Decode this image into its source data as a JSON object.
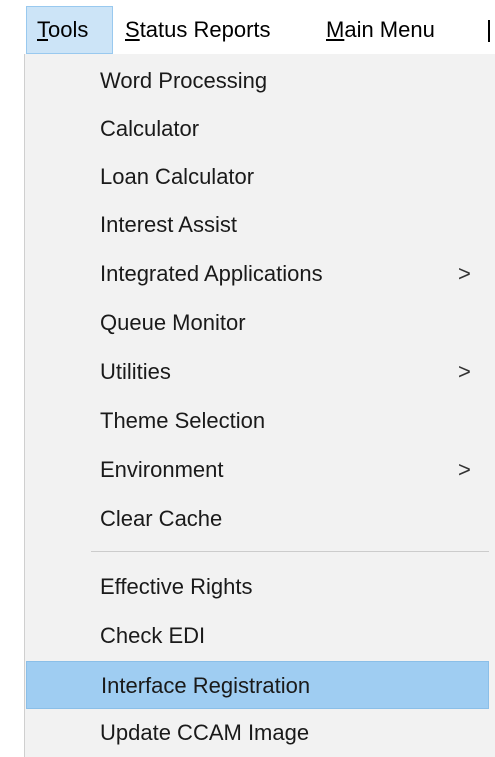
{
  "menubar": {
    "items": [
      {
        "label": "Tools"
      },
      {
        "label": "Status Reports"
      },
      {
        "label": "Main Menu"
      }
    ]
  },
  "tools_menu": {
    "group1": [
      {
        "label": "Word Processing"
      },
      {
        "label": "Calculator"
      },
      {
        "label": "Loan Calculator"
      },
      {
        "label": "Interest Assist"
      },
      {
        "label": "Integrated Applications",
        "submenu_glyph": ">"
      },
      {
        "label": "Queue Monitor"
      },
      {
        "label": "Utilities",
        "submenu_glyph": ">"
      },
      {
        "label": "Theme Selection"
      },
      {
        "label": "Environment",
        "submenu_glyph": ">"
      },
      {
        "label": "Clear Cache"
      }
    ],
    "group2": [
      {
        "label": "Effective Rights"
      },
      {
        "label": "Check EDI"
      },
      {
        "label": "Interface Registration",
        "state": "highlighted"
      },
      {
        "label": "Update CCAM Image"
      }
    ]
  },
  "colors": {
    "menu_background": "#f2f2f2",
    "highlight": "#9fcdf2",
    "open_menu_header": "#cce4f7"
  },
  "icons": {
    "submenu_arrow": "chevron-right-icon"
  }
}
